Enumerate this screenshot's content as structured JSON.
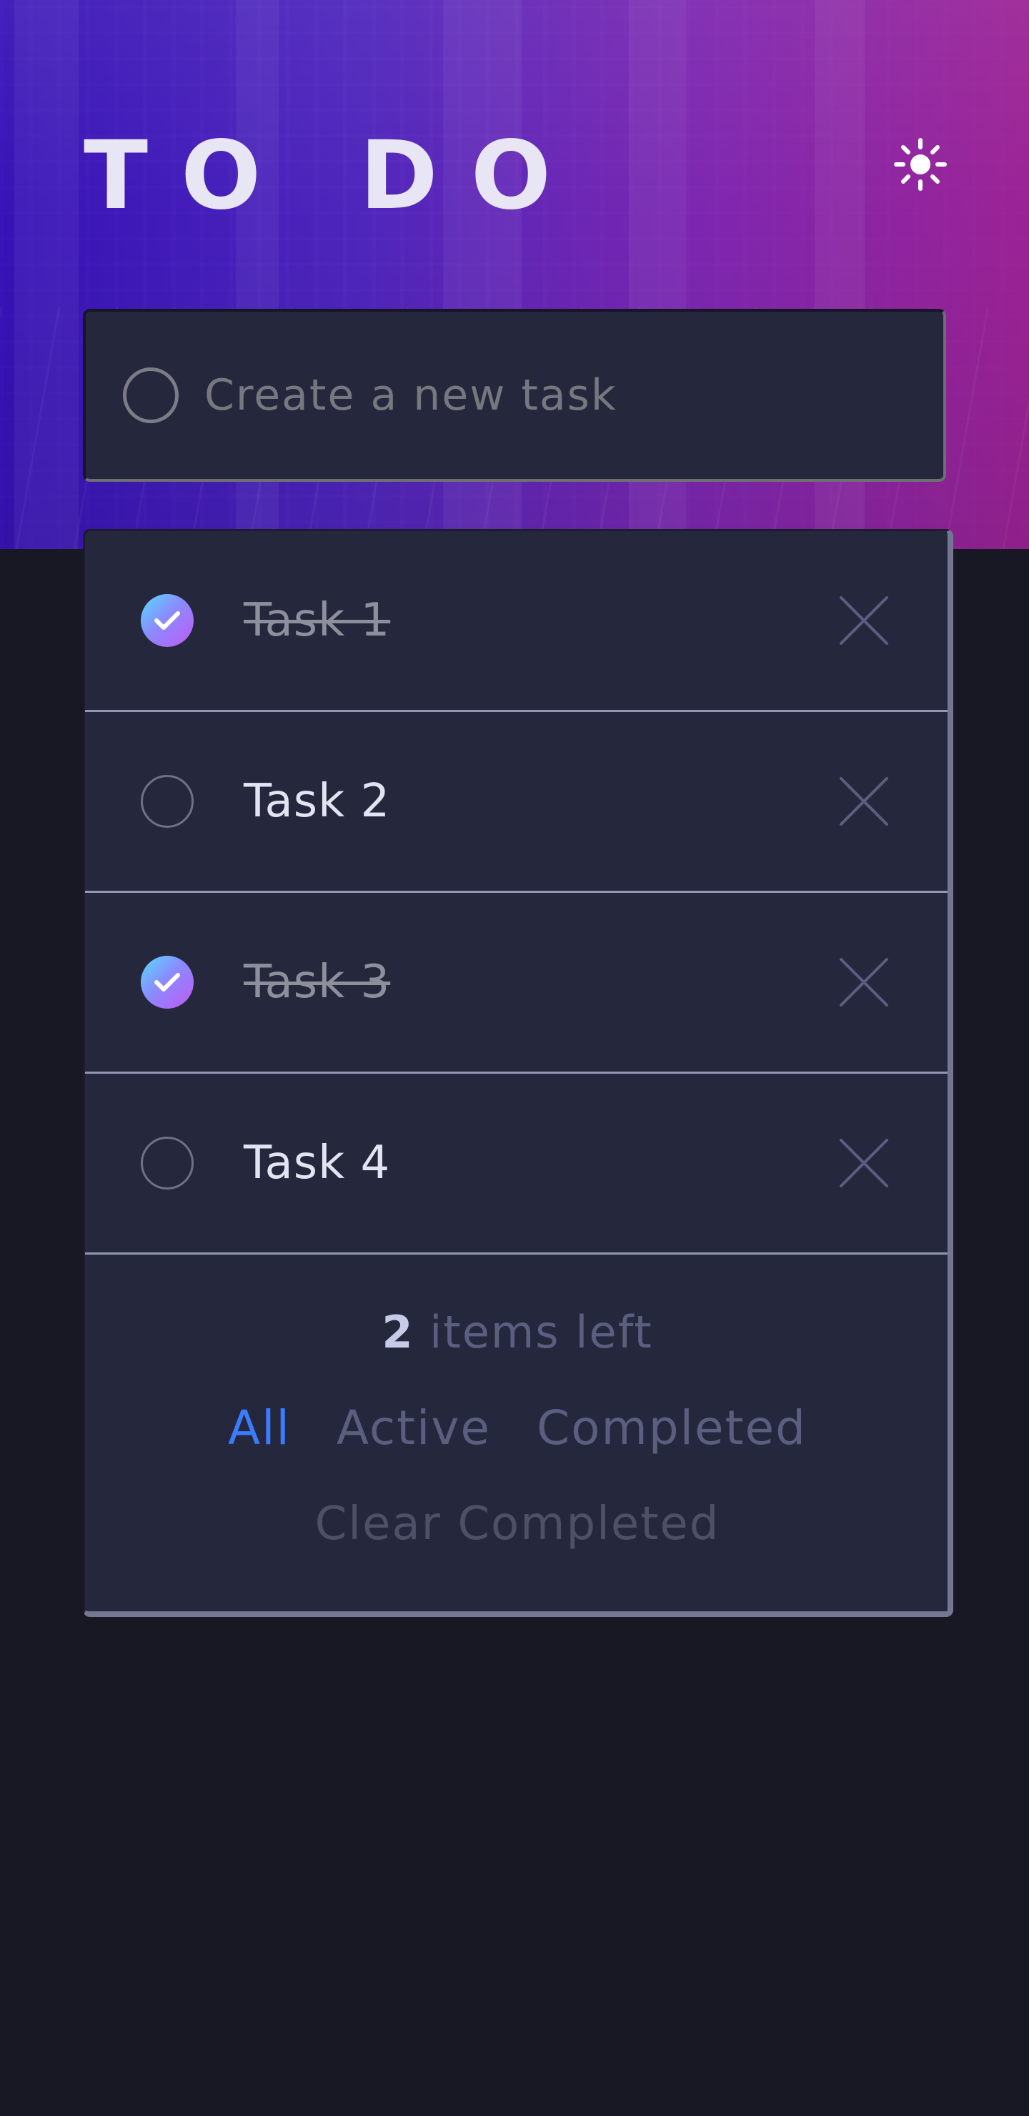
{
  "header": {
    "title": "TO DO",
    "theme_toggle_icon": "sun-icon"
  },
  "new_task": {
    "placeholder": "Create a new task",
    "value": ""
  },
  "tasks": [
    {
      "label": "Task 1",
      "completed": true
    },
    {
      "label": "Task 2",
      "completed": false
    },
    {
      "label": "Task 3",
      "completed": true
    },
    {
      "label": "Task 4",
      "completed": false
    }
  ],
  "footer": {
    "items_left_count": "2",
    "items_left_label": "items left",
    "filters": {
      "all": "All",
      "active": "Active",
      "completed": "Completed"
    },
    "active_filter": "all",
    "clear_label": "Clear Completed"
  },
  "colors": {
    "accent": "#3a7cfd",
    "check_gradient_start": "#55ddff",
    "check_gradient_end": "#c058f3",
    "card_bg": "#25273d",
    "page_bg": "#171823"
  }
}
